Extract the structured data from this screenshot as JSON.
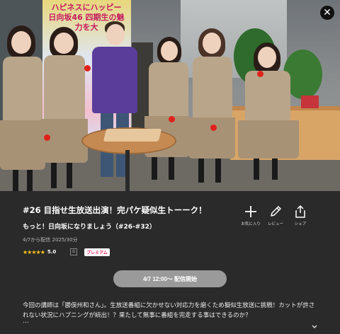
{
  "hero": {
    "board_text": "ハピネスにハッピー 日向坂46 四期生の魅力を大",
    "image_desc_name": "hero-image"
  },
  "close_icon": "close-icon",
  "title": "#26 目指せ生放送出演！完パケ疑似生トーーク！",
  "subtitle": "もっと！日向坂になりましょう（#26-#32）",
  "meta": "4/7から配信 2025/30分",
  "rating": {
    "stars": "★★★★★",
    "value": "5.0"
  },
  "badges": {
    "age": "G",
    "premium": "プレミアム"
  },
  "actions": [
    {
      "label": "お気に入り",
      "icon": "plus-icon"
    },
    {
      "label": "レビュー",
      "icon": "pencil-icon"
    },
    {
      "label": "シェア",
      "icon": "share-icon"
    }
  ],
  "start_button": "4/7 12:00〜 配信開始",
  "description": "今回の講師は「勝俣州和さん」。生放送番組に欠かせない対応力を磨くため擬似生放送に挑戦！カットが許されない状況にハプニングが続出！？果たして無事に番組を完走する事はできるのか？",
  "more": "…",
  "colors": {
    "background": "#2a2a2a",
    "star": "#ffc21a",
    "premium": "#e0245e",
    "button": "#9a9a9a"
  }
}
